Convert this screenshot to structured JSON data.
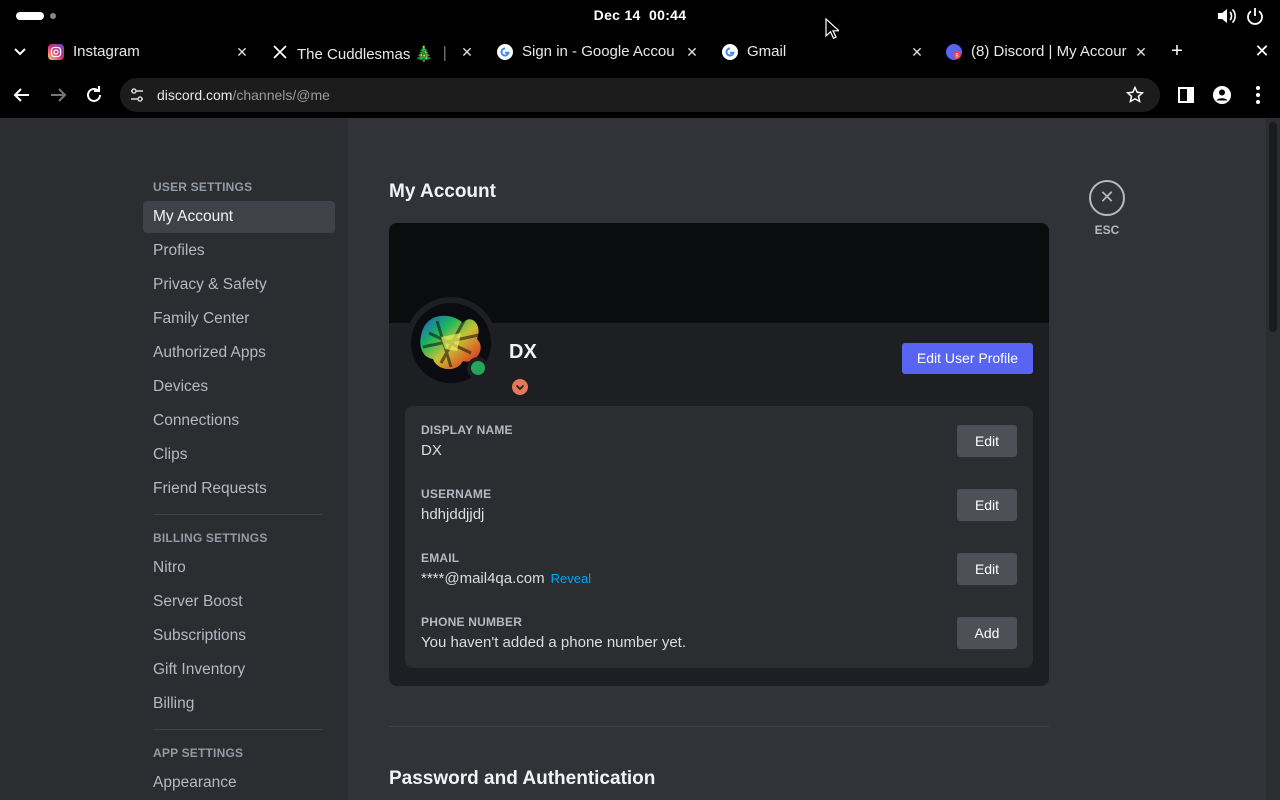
{
  "os": {
    "date": "Dec 14",
    "time": "00:44"
  },
  "tabs": [
    {
      "title": "Instagram",
      "icon": "instagram-icon"
    },
    {
      "title": "The Cuddlesmas 🎄 ｜",
      "icon": "x-icon"
    },
    {
      "title": "Sign in - Google Accou",
      "icon": "google-icon"
    },
    {
      "title": "Gmail",
      "icon": "google-icon"
    },
    {
      "title": "(8) Discord | My Accour",
      "icon": "discord-icon",
      "active": true
    }
  ],
  "url": {
    "host": "discord.com",
    "path": "/channels/@me"
  },
  "sidebar": {
    "user_settings_header": "USER SETTINGS",
    "user_items": [
      "My Account",
      "Profiles",
      "Privacy & Safety",
      "Family Center",
      "Authorized Apps",
      "Devices",
      "Connections",
      "Clips",
      "Friend Requests"
    ],
    "billing_header": "BILLING SETTINGS",
    "billing_items": [
      "Nitro",
      "Server Boost",
      "Subscriptions",
      "Gift Inventory",
      "Billing"
    ],
    "app_header": "APP SETTINGS",
    "app_items": [
      "Appearance"
    ]
  },
  "main": {
    "title": "My Account",
    "esc_label": "ESC",
    "profile": {
      "name": "DX",
      "edit_profile_label": "Edit User Profile"
    },
    "fields": [
      {
        "label": "DISPLAY NAME",
        "value": "DX",
        "action": "Edit"
      },
      {
        "label": "USERNAME",
        "value": "hdhjddjjdj",
        "action": "Edit"
      },
      {
        "label": "EMAIL",
        "value": "****@mail4qa.com",
        "link": "Reveal",
        "action": "Edit"
      },
      {
        "label": "PHONE NUMBER",
        "value": "You haven't added a phone number yet.",
        "action": "Add"
      }
    ],
    "next_section": "Password and Authentication"
  },
  "colors": {
    "blurple": "#5865f2",
    "online": "#23a55a",
    "link": "#00a8fc"
  }
}
